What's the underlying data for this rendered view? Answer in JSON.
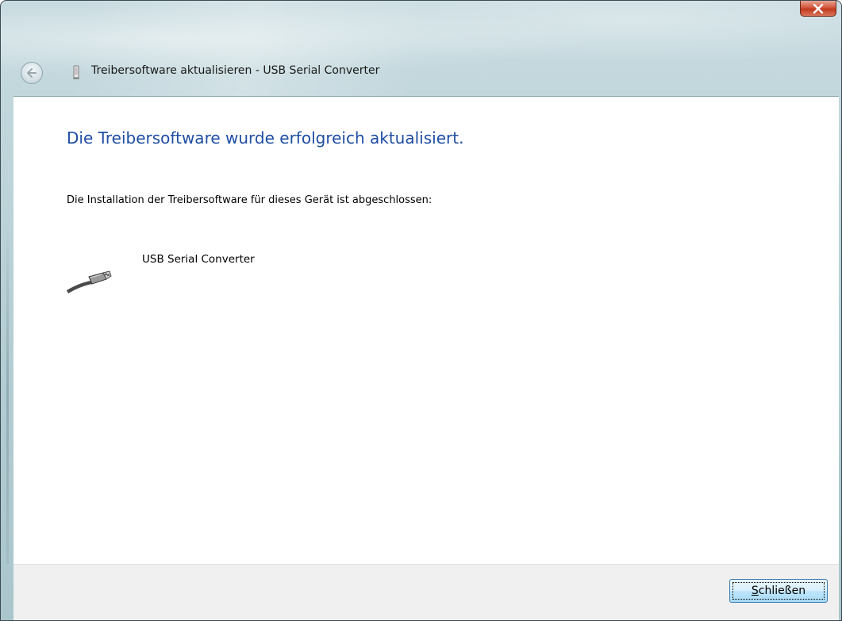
{
  "window": {
    "title": "Treibersoftware aktualisieren - USB Serial Converter"
  },
  "content": {
    "heading": "Die Treibersoftware wurde erfolgreich aktualisiert.",
    "description": "Die Installation der Treibersoftware für dieses Gerät ist abgeschlossen:",
    "device_name": "USB Serial Converter"
  },
  "footer": {
    "close_button": {
      "mnemonic": "S",
      "rest": "chließen"
    }
  },
  "icons": {
    "close": "close-icon",
    "back": "back-arrow-icon",
    "title": "usb-device-icon",
    "device": "usb-plug-icon"
  },
  "colors": {
    "heading": "#1f4ea3",
    "close_button_red": "#c23a1e",
    "button_border": "#3c7fb1"
  }
}
